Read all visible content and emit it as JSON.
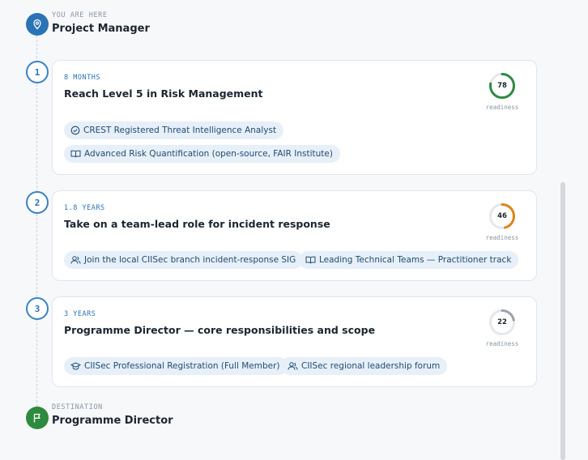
{
  "start": {
    "kicker": "YOU ARE HERE",
    "role": "Project Manager",
    "icon": "location-pin-icon"
  },
  "steps": [
    {
      "number": "1",
      "duration": "8 MONTHS",
      "title": "Reach Level 5 in Risk Management",
      "readiness": 78,
      "readiness_text": "78",
      "readiness_label": "readiness",
      "ring_color": "#2f8a44",
      "chips": [
        {
          "icon": "certificate-check-icon",
          "label": "CREST Registered Threat Intelligence Analyst"
        },
        {
          "icon": "book-icon",
          "label": "Advanced Risk Quantification (open-source, FAIR Institute)"
        }
      ]
    },
    {
      "number": "2",
      "duration": "1.8 YEARS",
      "title": "Take on a team-lead role for incident response",
      "readiness": 46,
      "readiness_text": "46",
      "readiness_label": "readiness",
      "ring_color": "#e0841a",
      "chips": [
        {
          "icon": "people-icon",
          "label": "Join the local CIISec branch incident-response SIG"
        },
        {
          "icon": "book-icon",
          "label": "Leading Technical Teams — Practitioner track"
        }
      ]
    },
    {
      "number": "3",
      "duration": "3 YEARS",
      "title": "Programme Director — core responsibilities and scope",
      "readiness": 22,
      "readiness_text": "22",
      "readiness_label": "readiness",
      "ring_color": "#9aa3ad",
      "chips": [
        {
          "icon": "graduation-cap-icon",
          "label": "CIISec Professional Registration (Full Member)"
        },
        {
          "icon": "people-icon",
          "label": "CIISec regional leadership forum"
        }
      ]
    }
  ],
  "destination": {
    "kicker": "DESTINATION",
    "role": "Programme Director",
    "icon": "flag-icon"
  },
  "colors": {
    "accent": "#2a73b5",
    "destination": "#2d8a3e",
    "chip_bg": "#e7f0f8",
    "ring_track": "#e4e8ec"
  }
}
